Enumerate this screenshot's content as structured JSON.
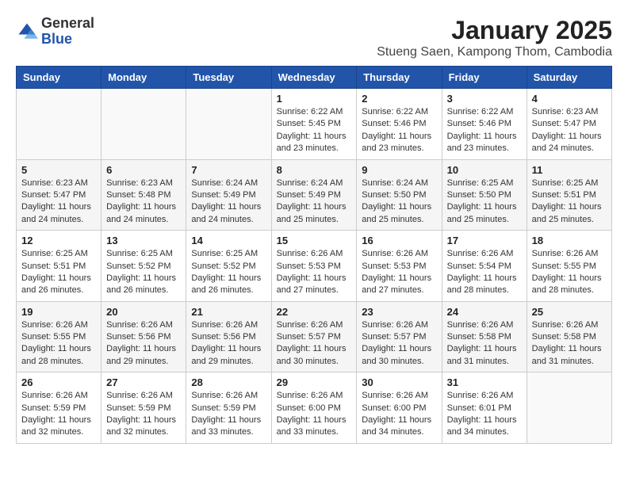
{
  "header": {
    "logo_general": "General",
    "logo_blue": "Blue",
    "month_title": "January 2025",
    "location": "Stueng Saen, Kampong Thom, Cambodia"
  },
  "weekdays": [
    "Sunday",
    "Monday",
    "Tuesday",
    "Wednesday",
    "Thursday",
    "Friday",
    "Saturday"
  ],
  "weeks": [
    [
      {
        "day": "",
        "sunrise": "",
        "sunset": "",
        "daylight": ""
      },
      {
        "day": "",
        "sunrise": "",
        "sunset": "",
        "daylight": ""
      },
      {
        "day": "",
        "sunrise": "",
        "sunset": "",
        "daylight": ""
      },
      {
        "day": "1",
        "sunrise": "Sunrise: 6:22 AM",
        "sunset": "Sunset: 5:45 PM",
        "daylight": "Daylight: 11 hours and 23 minutes."
      },
      {
        "day": "2",
        "sunrise": "Sunrise: 6:22 AM",
        "sunset": "Sunset: 5:46 PM",
        "daylight": "Daylight: 11 hours and 23 minutes."
      },
      {
        "day": "3",
        "sunrise": "Sunrise: 6:22 AM",
        "sunset": "Sunset: 5:46 PM",
        "daylight": "Daylight: 11 hours and 23 minutes."
      },
      {
        "day": "4",
        "sunrise": "Sunrise: 6:23 AM",
        "sunset": "Sunset: 5:47 PM",
        "daylight": "Daylight: 11 hours and 24 minutes."
      }
    ],
    [
      {
        "day": "5",
        "sunrise": "Sunrise: 6:23 AM",
        "sunset": "Sunset: 5:47 PM",
        "daylight": "Daylight: 11 hours and 24 minutes."
      },
      {
        "day": "6",
        "sunrise": "Sunrise: 6:23 AM",
        "sunset": "Sunset: 5:48 PM",
        "daylight": "Daylight: 11 hours and 24 minutes."
      },
      {
        "day": "7",
        "sunrise": "Sunrise: 6:24 AM",
        "sunset": "Sunset: 5:49 PM",
        "daylight": "Daylight: 11 hours and 24 minutes."
      },
      {
        "day": "8",
        "sunrise": "Sunrise: 6:24 AM",
        "sunset": "Sunset: 5:49 PM",
        "daylight": "Daylight: 11 hours and 25 minutes."
      },
      {
        "day": "9",
        "sunrise": "Sunrise: 6:24 AM",
        "sunset": "Sunset: 5:50 PM",
        "daylight": "Daylight: 11 hours and 25 minutes."
      },
      {
        "day": "10",
        "sunrise": "Sunrise: 6:25 AM",
        "sunset": "Sunset: 5:50 PM",
        "daylight": "Daylight: 11 hours and 25 minutes."
      },
      {
        "day": "11",
        "sunrise": "Sunrise: 6:25 AM",
        "sunset": "Sunset: 5:51 PM",
        "daylight": "Daylight: 11 hours and 25 minutes."
      }
    ],
    [
      {
        "day": "12",
        "sunrise": "Sunrise: 6:25 AM",
        "sunset": "Sunset: 5:51 PM",
        "daylight": "Daylight: 11 hours and 26 minutes."
      },
      {
        "day": "13",
        "sunrise": "Sunrise: 6:25 AM",
        "sunset": "Sunset: 5:52 PM",
        "daylight": "Daylight: 11 hours and 26 minutes."
      },
      {
        "day": "14",
        "sunrise": "Sunrise: 6:25 AM",
        "sunset": "Sunset: 5:52 PM",
        "daylight": "Daylight: 11 hours and 26 minutes."
      },
      {
        "day": "15",
        "sunrise": "Sunrise: 6:26 AM",
        "sunset": "Sunset: 5:53 PM",
        "daylight": "Daylight: 11 hours and 27 minutes."
      },
      {
        "day": "16",
        "sunrise": "Sunrise: 6:26 AM",
        "sunset": "Sunset: 5:53 PM",
        "daylight": "Daylight: 11 hours and 27 minutes."
      },
      {
        "day": "17",
        "sunrise": "Sunrise: 6:26 AM",
        "sunset": "Sunset: 5:54 PM",
        "daylight": "Daylight: 11 hours and 28 minutes."
      },
      {
        "day": "18",
        "sunrise": "Sunrise: 6:26 AM",
        "sunset": "Sunset: 5:55 PM",
        "daylight": "Daylight: 11 hours and 28 minutes."
      }
    ],
    [
      {
        "day": "19",
        "sunrise": "Sunrise: 6:26 AM",
        "sunset": "Sunset: 5:55 PM",
        "daylight": "Daylight: 11 hours and 28 minutes."
      },
      {
        "day": "20",
        "sunrise": "Sunrise: 6:26 AM",
        "sunset": "Sunset: 5:56 PM",
        "daylight": "Daylight: 11 hours and 29 minutes."
      },
      {
        "day": "21",
        "sunrise": "Sunrise: 6:26 AM",
        "sunset": "Sunset: 5:56 PM",
        "daylight": "Daylight: 11 hours and 29 minutes."
      },
      {
        "day": "22",
        "sunrise": "Sunrise: 6:26 AM",
        "sunset": "Sunset: 5:57 PM",
        "daylight": "Daylight: 11 hours and 30 minutes."
      },
      {
        "day": "23",
        "sunrise": "Sunrise: 6:26 AM",
        "sunset": "Sunset: 5:57 PM",
        "daylight": "Daylight: 11 hours and 30 minutes."
      },
      {
        "day": "24",
        "sunrise": "Sunrise: 6:26 AM",
        "sunset": "Sunset: 5:58 PM",
        "daylight": "Daylight: 11 hours and 31 minutes."
      },
      {
        "day": "25",
        "sunrise": "Sunrise: 6:26 AM",
        "sunset": "Sunset: 5:58 PM",
        "daylight": "Daylight: 11 hours and 31 minutes."
      }
    ],
    [
      {
        "day": "26",
        "sunrise": "Sunrise: 6:26 AM",
        "sunset": "Sunset: 5:59 PM",
        "daylight": "Daylight: 11 hours and 32 minutes."
      },
      {
        "day": "27",
        "sunrise": "Sunrise: 6:26 AM",
        "sunset": "Sunset: 5:59 PM",
        "daylight": "Daylight: 11 hours and 32 minutes."
      },
      {
        "day": "28",
        "sunrise": "Sunrise: 6:26 AM",
        "sunset": "Sunset: 5:59 PM",
        "daylight": "Daylight: 11 hours and 33 minutes."
      },
      {
        "day": "29",
        "sunrise": "Sunrise: 6:26 AM",
        "sunset": "Sunset: 6:00 PM",
        "daylight": "Daylight: 11 hours and 33 minutes."
      },
      {
        "day": "30",
        "sunrise": "Sunrise: 6:26 AM",
        "sunset": "Sunset: 6:00 PM",
        "daylight": "Daylight: 11 hours and 34 minutes."
      },
      {
        "day": "31",
        "sunrise": "Sunrise: 6:26 AM",
        "sunset": "Sunset: 6:01 PM",
        "daylight": "Daylight: 11 hours and 34 minutes."
      },
      {
        "day": "",
        "sunrise": "",
        "sunset": "",
        "daylight": ""
      }
    ]
  ]
}
